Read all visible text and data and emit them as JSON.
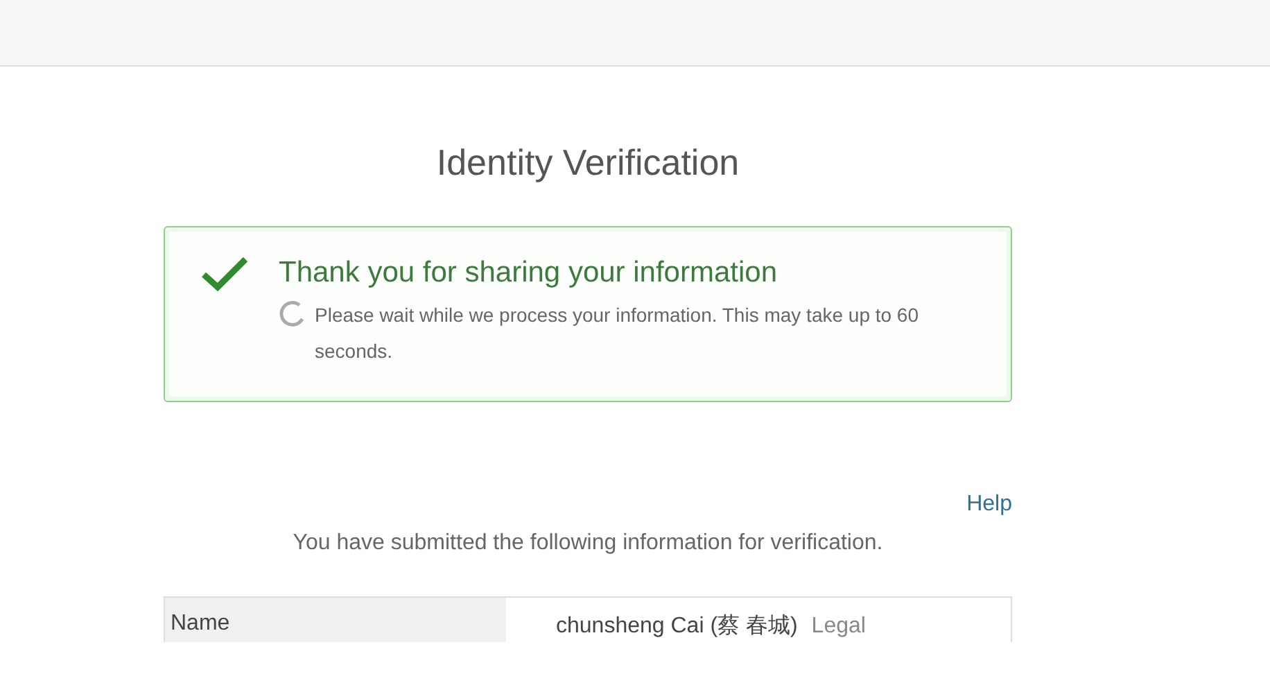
{
  "title": "Identity Verification",
  "notice": {
    "heading": "Thank you for sharing your information",
    "message": "Please wait while we process your information. This may take up to 60 seconds."
  },
  "help_link": "Help",
  "intro": "You have submitted the following information for verification.",
  "table": {
    "rows": [
      {
        "label": "Name",
        "value": "chunsheng Cai (蔡 春城)",
        "note": "Legal"
      }
    ]
  }
}
